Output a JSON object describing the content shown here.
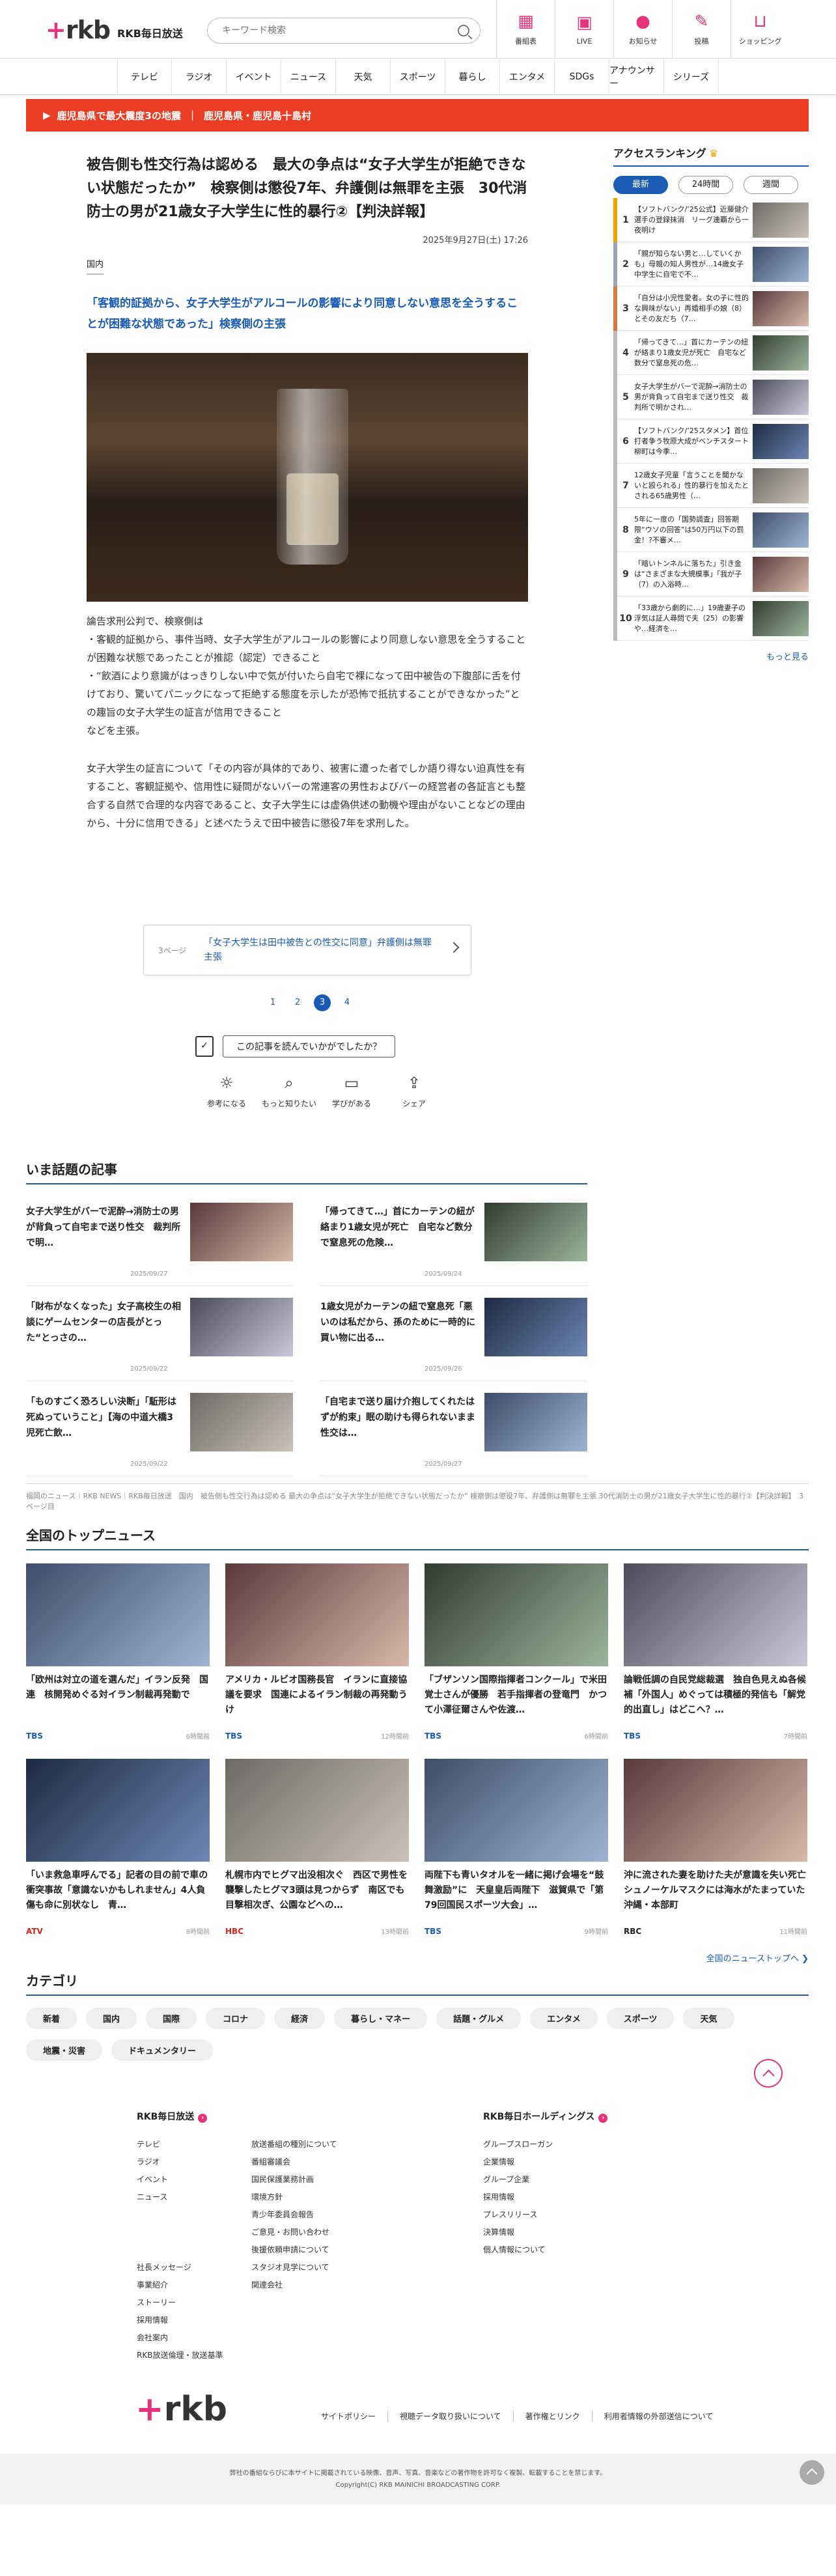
{
  "header": {
    "brand": "RKB毎日放送",
    "search_placeholder": "キーワード検索",
    "nav": [
      {
        "label": "番組表",
        "icon": "calendar-icon"
      },
      {
        "label": "LIVE",
        "icon": "live-icon"
      },
      {
        "label": "お知らせ",
        "icon": "bell-icon"
      },
      {
        "label": "投稿",
        "icon": "pen-icon"
      },
      {
        "label": "ショッピング",
        "icon": "cart-icon"
      }
    ]
  },
  "categories": [
    "テレビ",
    "ラジオ",
    "イベント",
    "ニュース",
    "天気",
    "スポーツ",
    "暮らし",
    "エンタメ",
    "SDGs",
    "アナウンサー",
    "シリーズ"
  ],
  "alert": {
    "label": "鹿児島県で最大震度3の地震",
    "sub": "鹿児島県・鹿児島十島村"
  },
  "article": {
    "title": "被告側も性交行為は認める　最大の争点は“女子大学生が拒絶できない状態だったか”　検察側は懲役7年、弁護側は無罪を主張　30代消防士の男が21歳女子大学生に性的暴行②【判決詳報】",
    "date": "2025年9月27日(土) 17:26",
    "genre": "国内",
    "lead": "「客観的証拠から、女子大学生がアルコールの影響により同意しない意思を全うすることが困難な状態であった」検察側の主張",
    "paragraphs": [
      "論告求刑公判で、検察側は\n・客観的証拠から、事件当時、女子大学生がアルコールの影響により同意しない意思を全うすることが困難な状態であったことが推認（認定）できること\n・“飲酒により意識がはっきりしない中で気が付いたら自宅で裸になって田中被告の下腹部に舌を付けており、驚いてパニックになって拒絶する態度を示したが恐怖で抵抗することができなかった”との趣旨の女子大学生の証言が信用できること\nなどを主張。",
      "女子大学生の証言について「その内容が具体的であり、被害に遭った者でしか語り得ない迫真性を有すること、客観証拠や、信用性に疑問がないバーの常連客の男性およびバーの経営者の各証言とも整合する自然で合理的な内容であること、女子大学生には虚偽供述の動機や理由がないことなどの理由から、十分に信用できる」と述べたうえで田中被告に懲役7年を求刑した。"
    ],
    "related_label": "3ページ",
    "related_title": "「女子大学生は田中被告との性交に同意」弁護側は無罪主張",
    "pages": [
      "1",
      "2",
      "3",
      "4"
    ],
    "survey_button": "この記事を読んでいかがでしたか？",
    "reactions": [
      {
        "label": "参考になる",
        "icon": "bulb-icon"
      },
      {
        "label": "もっと知りたい",
        "icon": "magnifier-icon"
      },
      {
        "label": "学びがある",
        "icon": "book-icon"
      },
      {
        "label": "シェア",
        "icon": "share-icon"
      }
    ]
  },
  "ranking": {
    "title": "アクセスランキング",
    "tabs": [
      "最新",
      "24時間",
      "週間"
    ],
    "items": [
      {
        "n": "1",
        "t": "【ソフトバンク/’25公式】近藤健介選手の登録抹消　リーグ連覇から一夜明け",
        "c": "#f0a500"
      },
      {
        "n": "2",
        "t": "「親が知らない男と…していくかも」母親の知人男性が…14歳女子中学生に自宅で不…",
        "c": "#9aa5b5"
      },
      {
        "n": "3",
        "t": "「自分は小児性愛者。女の子に性的な興味がない」再婚相手の娘（8）とその友だち（7…",
        "c": "#d97a3a"
      },
      {
        "n": "4",
        "t": "「帰ってきて…」首にカーテンの紐が絡まり1歳女児が死亡　自宅など数分で窒息死の危…",
        "c": "#bbb"
      },
      {
        "n": "5",
        "t": "女子大学生がバーで泥酔→消防士の男が背負って自宅まで送り性交　裁判所で明かされ…",
        "c": "#bbb"
      },
      {
        "n": "6",
        "t": "【ソフトバンク/’25スタメン】首位打者争う牧原大成がベンチスタート　柳町は今季…",
        "c": "#bbb"
      },
      {
        "n": "7",
        "t": "12歳女子児童「言うことを聞かないと殴られる」性的暴行を加えたとされる65歳男性（…",
        "c": "#bbb"
      },
      {
        "n": "8",
        "t": "5年に一度の「国勢調査」回答期限“ウソの回答”は50万円以下の罰金！?不審メ…",
        "c": "#bbb"
      },
      {
        "n": "9",
        "t": "「暗いトンネルに落ちた」引き金は“さまざまな大規模事」「我が子（7）の入浴時…",
        "c": "#bbb"
      },
      {
        "n": "10",
        "t": "「33歳から劇的に…」19歳妻子の浮気は証人尋問で夫（25）の影響や…経済を…",
        "c": "#bbb"
      }
    ],
    "more": "もっと見る"
  },
  "trending": {
    "title": "いま話題の記事",
    "items": [
      {
        "t": "女子大学生がバーで泥酔→消防士の男が背負って自宅まで送り性交　裁判所で明…",
        "d": "2025/09/27"
      },
      {
        "t": "「帰ってきて…」首にカーテンの紐が絡まり1歳女児が死亡　自宅など数分で窒息死の危険…",
        "d": "2025/09/24"
      },
      {
        "t": "「財布がなくなった」女子高校生の相談にゲームセンターの店長がとった“とっさの…",
        "d": "2025/09/22"
      },
      {
        "t": "1歳女児がカーテンの紐で窒息死「悪いのは私だから、孫のために一時的に買い物に出る…",
        "d": "2025/09/26"
      },
      {
        "t": "「ものすごく恐ろしい決断」「駈形は死ぬっていうこと」【海の中道大橋3児死亡飲…",
        "d": "2025/09/22"
      },
      {
        "t": "「自宅まで送り届け介抱してくれたはずが約束」眠の助けも得られないまま性交は…",
        "d": "2025/09/27"
      }
    ]
  },
  "breadcrumb": "福岡のニュース｜RKB NEWS｜RKB毎日放送　国内　被告側も性交行為は認める 最大の争点は“女子大学生が拒絶できない状態だったか” 検察側は懲役7年、弁護側は無罪を主張 30代消防士の男が21歳女子大学生に性的暴行②【判決詳報】　3ページ目",
  "national": {
    "title": "全国のトップニュース",
    "items": [
      {
        "t": "「欧州は対立の道を選んだ」イラン反発　国連　核開発めぐる対イラン制裁再発動で",
        "s": "TBS",
        "tm": "6時間前"
      },
      {
        "t": "アメリカ・ルビオ国務長官　イランに直接協議を要求　国連によるイラン制裁の再発動うけ",
        "s": "TBS",
        "tm": "12時間前"
      },
      {
        "t": "「ブザンソン国際指揮者コンクール」で米田覚士さんが優勝　若手指揮者の登竜門　かつて小澤征爾さんや佐渡…",
        "s": "TBS",
        "tm": "6時間前"
      },
      {
        "t": "論戦低調の自民党総裁選　独自色見えぬ各候補「外国人」めぐっては積極的発信も「解党的出直し」はどこへ？…",
        "s": "TBS",
        "tm": "7時間前"
      },
      {
        "t": "「いま救急車呼んでる」記者の目の前で車の衝突事故「意識ないかもしれません」4人負傷も命に別状なし　青…",
        "s": "ATV",
        "tm": "8時間前"
      },
      {
        "t": "札幌市内でヒグマ出没相次ぐ　西区で男性を襲撃したヒグマ3頭は見つからず　南区でも目撃相次ぎ、公園などへの…",
        "s": "HBC",
        "tm": "13時間前"
      },
      {
        "t": "両陛下も青いタオルを一緒に掲げ会場を“鼓舞激励”に　天皇皇后両陛下　滋賀県で「第79回国民スポーツ大会」…",
        "s": "TBS",
        "tm": "9時間前"
      },
      {
        "t": "沖に流された妻を助けた夫が意識を失い死亡　シュノーケルマスクには海水がたまっていた　沖縄・本部町",
        "s": "RBC",
        "tm": "11時間前"
      }
    ],
    "more": "全国のニューストップへ"
  },
  "category_section": {
    "title": "カテゴリ",
    "tags": [
      "新着",
      "国内",
      "国際",
      "コロナ",
      "経済",
      "暮らし・マネー",
      "話題・グルメ",
      "エンタメ",
      "スポーツ",
      "天気",
      "地震・災害",
      "ドキュメンタリー"
    ]
  },
  "footer": {
    "col1_title": "RKB毎日放送",
    "col1_a": [
      "テレビ",
      "ラジオ",
      "イベント",
      "ニュース",
      "",
      "",
      "",
      "社長メッセージ",
      "事業紹介",
      "ストーリー",
      "採用情報",
      "会社案内",
      "RKB放送倫理・放送基準"
    ],
    "col1_b": [
      "放送番組の種別について",
      "番組審議会",
      "国民保護業務計画",
      "環境方針",
      "青少年委員会報告",
      "ご意見・お問い合わせ",
      "後援依頼申請について",
      "スタジオ見学について",
      "関連会社"
    ],
    "col2_title": "RKB毎日ホールディングス",
    "col2": [
      "グループスローガン",
      "企業情報",
      "グループ企業",
      "採用情報",
      "プレスリリース",
      "決算情報",
      "個人情報について"
    ],
    "links": [
      "サイトポリシー",
      "視聴データ取り扱いについて",
      "著作権とリンク",
      "利用者情報の外部送信について"
    ],
    "notice": "弊社の番組ならびに本サイトに掲載されている映像、音声、写真、音楽などの著作物を許可なく複製、転載することを禁じます。",
    "copyright": "Copyright(C) RKB MAINICHI BROADCASTING CORP."
  }
}
